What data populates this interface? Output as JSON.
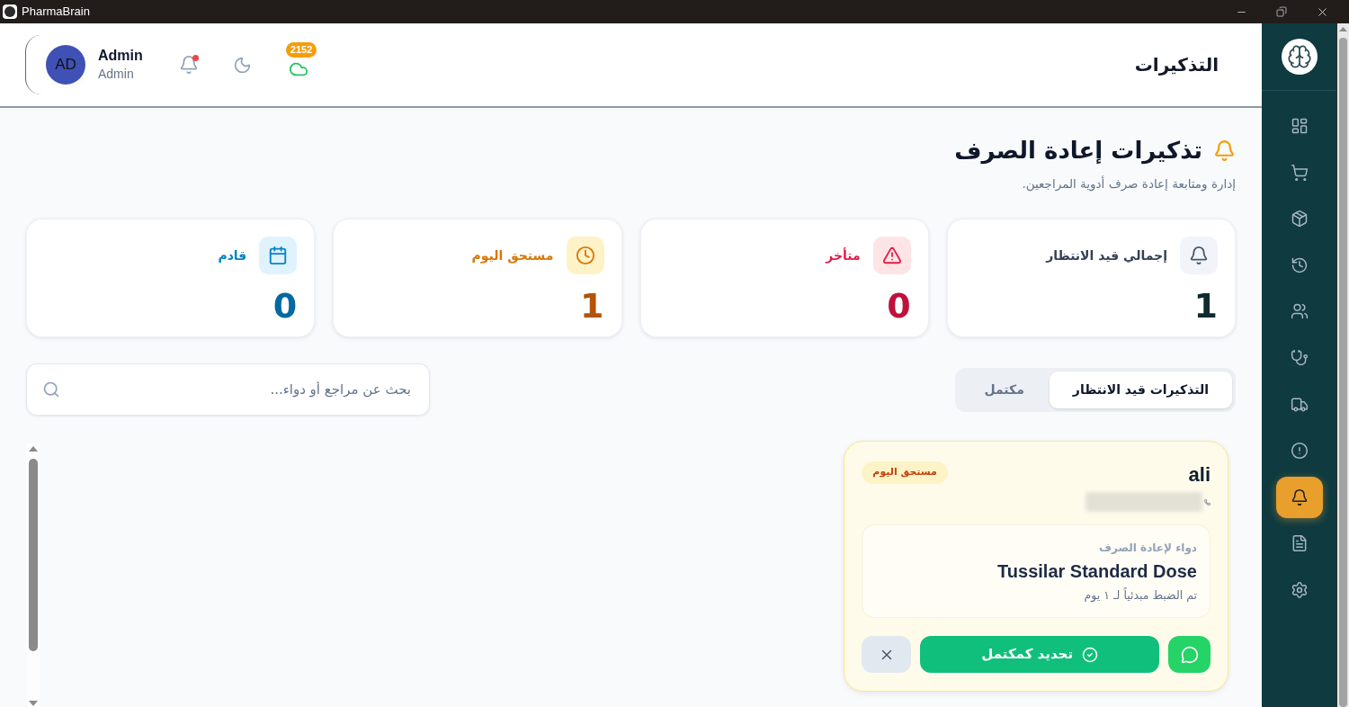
{
  "window": {
    "title": "PharmaBrain"
  },
  "header": {
    "title": "التذكيرات",
    "user": {
      "initials": "AD",
      "name": "Admin",
      "role": "Admin"
    },
    "notifications": {
      "unread": true
    },
    "sync": {
      "badge": "2152"
    }
  },
  "sidebar": {
    "items": [
      {
        "selected": false
      },
      {
        "selected": false
      },
      {
        "selected": false
      },
      {
        "selected": false
      },
      {
        "selected": false
      },
      {
        "selected": false
      },
      {
        "selected": false
      },
      {
        "selected": false
      },
      {
        "selected": true
      },
      {
        "selected": false
      },
      {
        "selected": false
      }
    ]
  },
  "page": {
    "title": "تذكيرات إعادة الصرف",
    "subtitle": "إدارة ومتابعة إعادة صرف أدوية المراجعين."
  },
  "stats": [
    {
      "kind": "total",
      "label": "إجمالي قيد الانتظار",
      "value": "1"
    },
    {
      "kind": "overdue",
      "label": "متأخر",
      "value": "0"
    },
    {
      "kind": "today",
      "label": "مستحق اليوم",
      "value": "1"
    },
    {
      "kind": "upcoming",
      "label": "قادم",
      "value": "0"
    }
  ],
  "tabs": [
    {
      "label": "التذكيرات قيد الانتظار",
      "selected": true
    },
    {
      "label": "مكتمل",
      "selected": false
    }
  ],
  "search": {
    "placeholder": "بحث عن مراجع أو دواء..."
  },
  "reminders": [
    {
      "kind": "today",
      "patient": "ali",
      "status": "مستحق اليوم",
      "medicine_label": "دواء لإعادة الصرف",
      "medicine": "Tussilar Standard Dose",
      "note": "تم الضبط مبدئياً لـ ١ يوم",
      "complete_button": "تحديد كمكتمل"
    }
  ]
}
